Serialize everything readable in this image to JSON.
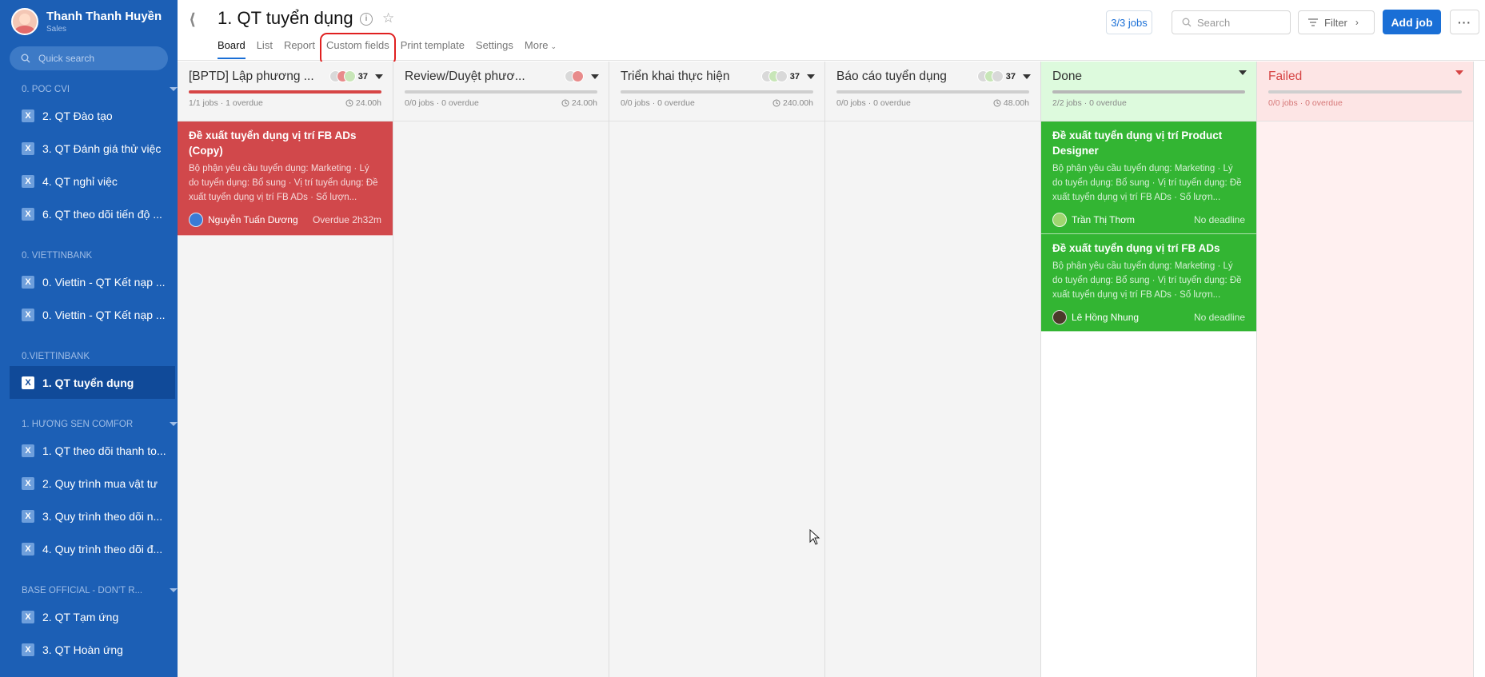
{
  "user": {
    "name": "Thanh Thanh Huyền",
    "role": "Sales"
  },
  "sidebar": {
    "quick_search_placeholder": "Quick search",
    "sections": [
      {
        "title": "0. POC CVI",
        "items": [
          "2. QT Đào tạo",
          "3. QT Đánh giá thử việc",
          "4. QT nghỉ việc",
          "6. QT theo dõi tiến độ ..."
        ]
      },
      {
        "title": "0. VIETTINBANK",
        "items": [
          "0. Viettin - QT Kết nạp ...",
          "0. Viettin - QT Kết nạp ..."
        ]
      },
      {
        "title": "0.VIETTINBANK",
        "items": [
          "1. QT tuyển dụng"
        ]
      },
      {
        "title": "1. HƯƠNG SEN COMFOR",
        "items": [
          "1. QT theo dõi thanh to...",
          "2. Quy trình mua vật tư",
          "3. Quy trình theo dõi n...",
          "4. Quy trình theo dõi đ..."
        ]
      },
      {
        "title": "BASE OFFICIAL - DON'T R...",
        "items": [
          "2. QT Tạm ứng",
          "3. QT Hoàn ứng"
        ]
      }
    ],
    "active_item": "1. QT tuyển dụng"
  },
  "header": {
    "title": "1. QT tuyển dụng",
    "tabs": [
      "Board",
      "List",
      "Report",
      "Custom fields",
      "Print template",
      "Settings",
      "More"
    ],
    "active_tab": "Board",
    "highlighted_tab": "Custom fields",
    "jobs_count": "3/3 jobs",
    "search_placeholder": "Search",
    "filter_label": "Filter",
    "add_job_label": "Add job",
    "more_label": "···"
  },
  "columns": [
    {
      "title": "[BPTD] Lập phương ...",
      "count": "37",
      "stats": "1/1 jobs · 1 overdue",
      "hours": "24.00h",
      "cards": [
        {
          "title": "Đề xuất tuyển dụng vị trí FB ADs (Copy)",
          "desc": "Bộ phận yêu cầu tuyển dụng: Marketing · Lý do tuyển dụng: Bổ sung · Vị trí tuyển dụng: Đề xuất tuyển dụng vị trí FB ADs · Số lượn...",
          "assignee": "Nguyễn Tuấn Dương",
          "due": "Overdue 2h32m"
        }
      ]
    },
    {
      "title": "Review/Duyệt phươ...",
      "count": "",
      "stats": "0/0 jobs · 0 overdue",
      "hours": "24.00h",
      "cards": []
    },
    {
      "title": "Triển khai thực hiện",
      "count": "37",
      "stats": "0/0 jobs · 0 overdue",
      "hours": "240.00h",
      "cards": []
    },
    {
      "title": "Báo cáo tuyển dụng",
      "count": "37",
      "stats": "0/0 jobs · 0 overdue",
      "hours": "48.00h",
      "cards": []
    },
    {
      "title": "Done",
      "count": "",
      "stats": "2/2 jobs · 0 overdue",
      "hours": "",
      "cards": [
        {
          "title": "Đề xuất tuyển dụng vị trí Product Designer",
          "desc": "Bộ phận yêu cầu tuyển dụng: Marketing · Lý do tuyển dụng: Bổ sung · Vị trí tuyển dụng: Đề xuất tuyển dụng vị trí FB ADs · Số lượn...",
          "assignee": "Trần Thị Thơm",
          "due": "No deadline"
        },
        {
          "title": "Đề xuất tuyển dụng vị trí FB ADs",
          "desc": "Bộ phận yêu cầu tuyển dụng: Marketing · Lý do tuyển dụng: Bổ sung · Vị trí tuyển dụng: Đề xuất tuyển dụng vị trí FB ADs · Số lượn...",
          "assignee": "Lê Hồng Nhung",
          "due": "No deadline"
        }
      ]
    },
    {
      "title": "Failed",
      "count": "",
      "stats": "0/0 jobs · 0 overdue",
      "hours": "",
      "cards": []
    }
  ],
  "colors": {
    "sidebar": "#1c5fb5",
    "accent": "#1a6fd6",
    "overdue_card": "#d1484b",
    "done_card": "#33b533",
    "highlight_box": "#e02020"
  }
}
